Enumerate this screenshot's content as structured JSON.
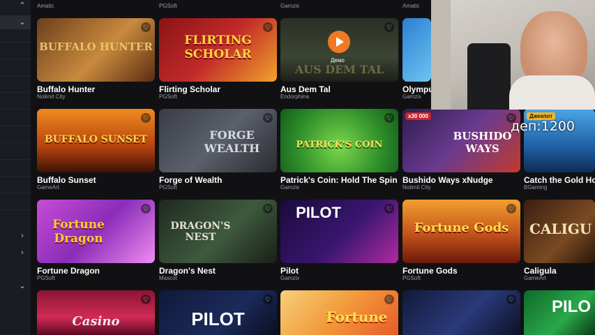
{
  "top_row_providers": [
    "Amatic",
    "PGSoft",
    "Gamzix",
    "Amatic"
  ],
  "games": [
    {
      "title": "Buffalo Hunter",
      "provider": "Nolimit City",
      "logo": "BUFFALO HUNTER"
    },
    {
      "title": "Flirting Scholar",
      "provider": "PGSoft",
      "logo": "FLIRTING SCHOLAR"
    },
    {
      "title": "Aus Dem Tal",
      "provider": "Endorphina",
      "logo": "AUS DEM TAL",
      "hover_label": "Демо"
    },
    {
      "title": "Olympus",
      "provider": "Gamzix",
      "logo": ""
    },
    {
      "title": "Buffalo Sunset",
      "provider": "GameArt",
      "logo": "BUFFALO SUNSET"
    },
    {
      "title": "Forge of Wealth",
      "provider": "PGSoft",
      "logo": "FORGE WEALTH"
    },
    {
      "title": "Patrick's Coin: Hold The Spin",
      "provider": "Gamzix",
      "logo": "PATRICK'S COIN"
    },
    {
      "title": "Bushido Ways xNudge",
      "provider": "Nolimit City",
      "logo": "BUSHIDO WAYS",
      "badge": "x30 000"
    },
    {
      "title": "Catch the Gold Hold and",
      "provider": "BGaming",
      "logo": "",
      "badge": "Джекпот"
    },
    {
      "title": "Fortune Dragon",
      "provider": "PGSoft",
      "logo": "Fortune Dragon"
    },
    {
      "title": "Dragon's Nest",
      "provider": "Mascot",
      "logo": "DRAGON'S NEST"
    },
    {
      "title": "Pilot",
      "provider": "Gamzix",
      "logo": "PILOT"
    },
    {
      "title": "Fortune Gods",
      "provider": "PGSoft",
      "logo": "Fortune Gods"
    },
    {
      "title": "Caligula",
      "provider": "GameArt",
      "logo": "CALIGU"
    },
    {
      "title": "",
      "provider": "",
      "logo": "Casino"
    },
    {
      "title": "",
      "provider": "",
      "logo": "PILOT"
    },
    {
      "title": "",
      "provider": "",
      "logo": "Fortune"
    },
    {
      "title": "",
      "provider": "",
      "logo": ""
    },
    {
      "title": "",
      "provider": "",
      "logo": "PILO"
    }
  ],
  "stream_overlay": "деп:1200"
}
